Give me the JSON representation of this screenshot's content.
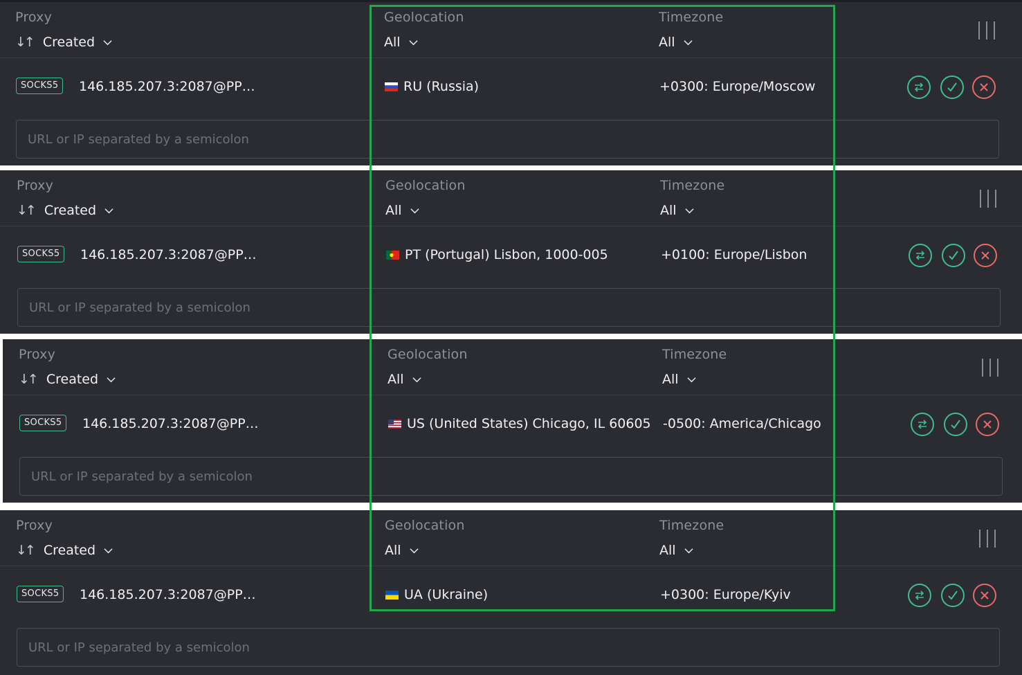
{
  "headers": {
    "proxy": "Proxy",
    "sort": "Created",
    "geolocation": "Geolocation",
    "geo_filter": "All",
    "timezone": "Timezone",
    "tz_filter": "All"
  },
  "placeholder": "URL or IP separated by a semicolon",
  "rows": [
    {
      "type": "SOCKS5",
      "proxy": "146.185.207.3:2087@PP…",
      "flag": "RU",
      "geo": "RU (Russia)",
      "tz": "+0300: Europe/Moscow"
    },
    {
      "type": "SOCKS5",
      "proxy": "146.185.207.3:2087@PP…",
      "flag": "PT",
      "geo": "PT (Portugal) Lisbon, 1000-005",
      "tz": "+0100: Europe/Lisbon"
    },
    {
      "type": "SOCKS5",
      "proxy": "146.185.207.3:2087@PP…",
      "flag": "US",
      "geo": "US (United States) Chicago, IL 60605",
      "tz": "-0500: America/Chicago"
    },
    {
      "type": "SOCKS5",
      "proxy": "146.185.207.3:2087@PP…",
      "flag": "UA",
      "geo": "UA (Ukraine)",
      "tz": "+0300: Europe/Kyiv"
    }
  ],
  "colors": {
    "panel": "#2b2c32",
    "accent_green": "#3fbd8e",
    "accent_red": "#e86a6a",
    "highlight": "#1fa84c"
  },
  "icons": [
    "sort-icon",
    "chevron-down-icon",
    "columns-icon",
    "swap-icon",
    "check-icon",
    "close-icon"
  ]
}
